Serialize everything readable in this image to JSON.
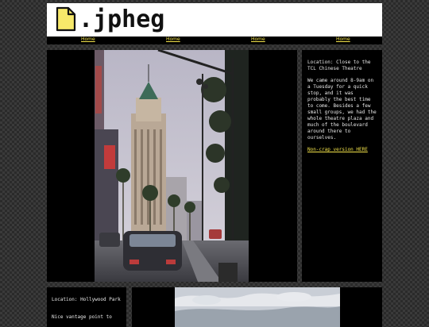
{
  "site": {
    "logo_text": ".jpheg",
    "logo_icon": "document-icon"
  },
  "nav": {
    "items": [
      "Home",
      "Home",
      "Home",
      "Home"
    ]
  },
  "post1": {
    "location": "Location: Close to the TCL Chinese Theatre",
    "description": "We came around 8-9am on a Tuesday for a quick stop, and it was probably the best time to come. Besides a few small groups, we had the whole theatre plaza and much of the boulevard around there to ourselves.",
    "link_text": "Non-crap version HERE"
  },
  "post2": {
    "location": "Location: Hollywood Park",
    "description": "Nice vantage point to"
  },
  "colors": {
    "link": "#f4e44a",
    "panel": "#000000",
    "header": "#ffffff"
  }
}
